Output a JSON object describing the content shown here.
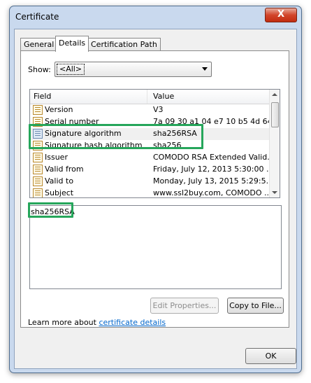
{
  "window": {
    "title": "Certificate",
    "close_glyph": "X"
  },
  "tabs": [
    {
      "label": "General"
    },
    {
      "label": "Details"
    },
    {
      "label": "Certification Path"
    }
  ],
  "show": {
    "label": "Show:",
    "value": "<All>"
  },
  "list": {
    "columns": [
      "Field",
      "Value"
    ],
    "rows": [
      {
        "field": "Version",
        "value": "V3"
      },
      {
        "field": "Serial number",
        "value": "7a 09 30 a1 04 e7 10 b5 4d 64..."
      },
      {
        "field": "Signature algorithm",
        "value": "sha256RSA"
      },
      {
        "field": "Signature hash algorithm",
        "value": "sha256"
      },
      {
        "field": "Issuer",
        "value": "COMODO RSA Extended Valid..."
      },
      {
        "field": "Valid from",
        "value": "Friday, July 12, 2013 5:30:00 ..."
      },
      {
        "field": "Valid to",
        "value": "Monday, July 13, 2015 5:29:5..."
      },
      {
        "field": "Subject",
        "value": "www.ssl2buy.com, COMODO ..."
      }
    ]
  },
  "detail": {
    "text": "sha256RSA"
  },
  "buttons": {
    "edit_properties": "Edit Properties...",
    "copy_to_file": "Copy to File...",
    "ok": "OK"
  },
  "learn_more": {
    "prefix": "Learn more about ",
    "link": "certificate details"
  },
  "colors": {
    "highlight": "#26a65b",
    "link": "#0066cc"
  }
}
